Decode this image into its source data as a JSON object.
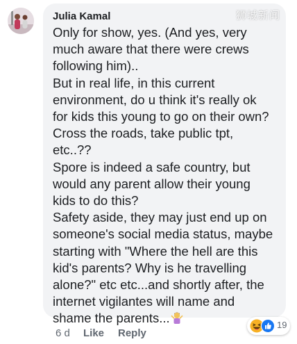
{
  "comment": {
    "author": "Julia Kamal",
    "text": "Only for show, yes. (And yes, very\nmuch aware that there were crews\nfollowing him)..\nBut in real life, in this current\nenvironment, do u think it's really ok\nfor kids this young to go on their own?\nCross the roads, take public tpt,\netc..??\nSpore is indeed a safe country, but\nwould any parent allow their young\nkids to do this?\nSafety aside, they may just end up on\nsomeone's social media status, maybe\nstarting with \"Where the hell are this\nkid's parents? Why is he travelling\nalone?\" etc etc...and shortly after, the\ninternet vigilantes will name and\nshame the parents...",
    "end_emoji": "person-shrugging-icon",
    "watermark": "狮城新闻"
  },
  "footer": {
    "time": "6 d",
    "like_label": "Like",
    "reply_label": "Reply"
  },
  "reactions": {
    "icons": [
      "laugh-reaction-icon",
      "like-reaction-icon"
    ],
    "count": "19"
  },
  "colors": {
    "bubble": "#f2f3f5",
    "text": "#1c1e21",
    "meta": "#606770",
    "like_blue": "#1877f2",
    "haha_yellow": "#f7b125"
  }
}
